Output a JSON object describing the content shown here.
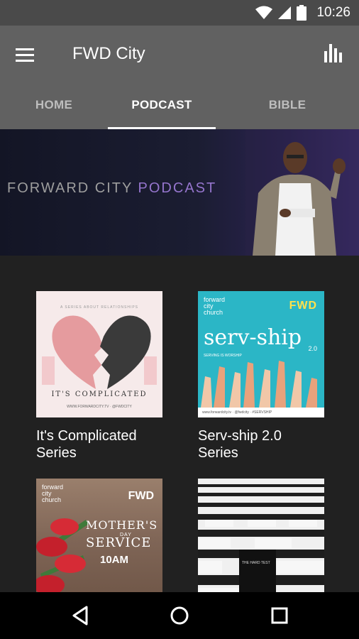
{
  "status_bar": {
    "time": "10:26",
    "icons": [
      "wifi-icon",
      "cell-signal-icon",
      "battery-icon"
    ]
  },
  "app_bar": {
    "title": "FWD City",
    "menu_icon": "hamburger-menu-icon",
    "action_icon": "bar-chart-icon"
  },
  "tabs": [
    {
      "label": "HOME",
      "active": false
    },
    {
      "label": "PODCAST",
      "active": true
    },
    {
      "label": "BIBLE",
      "active": false
    }
  ],
  "banner": {
    "text_main": "FORWARD CITY",
    "text_accent": "PODCAST"
  },
  "series": [
    {
      "title_line1": "It's Complicated",
      "title_line2": "Series",
      "art": {
        "headline": "IT'S COMPLICATED",
        "topline": "A SERIES ABOUT RELATIONSHIPS",
        "footer": "WWW.FORWARDCITY.TV  ·  @FWDCITY"
      }
    },
    {
      "title_line1": "Serv-ship 2.0",
      "title_line2": "Series",
      "art": {
        "brand": [
          "forward",
          "city",
          "church"
        ],
        "logo": "FWD",
        "title": "serv-ship",
        "version": "2.0",
        "subtitle": "SERVING IS WORSHIP",
        "footer": "www.forwardcity.tv  ·  @fwdcity  ·  #SERVSHIP"
      }
    },
    {
      "title_line1": "",
      "title_line2": "",
      "art": {
        "brand": [
          "forward",
          "city",
          "church"
        ],
        "logo": "FWD",
        "line1": "MOTHER'S",
        "line2": "DAY",
        "line3": "SERVICE",
        "line4": "10AM"
      }
    },
    {
      "title_line1": "",
      "title_line2": "",
      "art": {
        "sign": "THE HARD TEST"
      }
    }
  ],
  "nav_bar": {
    "back_icon": "back-triangle-icon",
    "home_icon": "home-circle-icon",
    "recents_icon": "recents-square-icon"
  },
  "colors": {
    "status_bar": "#4a4a4a",
    "app_bar": "#616161",
    "background": "#212121",
    "banner_accent": "#9575cd",
    "servship_teal": "#2bb6c6",
    "fwd_yellow": "#ffe14d"
  }
}
